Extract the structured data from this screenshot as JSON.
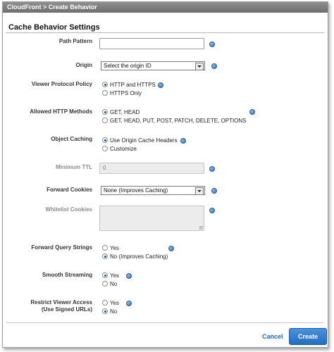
{
  "window": {
    "title": "CloudFront > Create Behavior"
  },
  "section": {
    "title": "Cache Behavior Settings"
  },
  "fields": {
    "path_pattern": {
      "label": "Path Pattern",
      "value": ""
    },
    "origin": {
      "label": "Origin",
      "selected": "Select the origin ID"
    },
    "viewer_protocol_policy": {
      "label": "Viewer Protocol Policy",
      "options": [
        "HTTP and HTTPS",
        "HTTPS Only"
      ],
      "selected_index": 0
    },
    "allowed_http_methods": {
      "label": "Allowed HTTP Methods",
      "options": [
        "GET, HEAD",
        "GET, HEAD, PUT, POST, PATCH, DELETE, OPTIONS"
      ],
      "selected_index": 0
    },
    "object_caching": {
      "label": "Object Caching",
      "options": [
        "Use Origin Cache Headers",
        "Customize"
      ],
      "selected_index": 0
    },
    "minimum_ttl": {
      "label": "Minimum TTL",
      "value": "0"
    },
    "forward_cookies": {
      "label": "Forward Cookies",
      "selected": "None (Improves Caching)"
    },
    "whitelist_cookies": {
      "label": "Whitelist Cookies",
      "value": ""
    },
    "forward_query_strings": {
      "label": "Forward Query Strings",
      "options": [
        "Yes",
        "No (Improves Caching)"
      ],
      "selected_index": 1
    },
    "smooth_streaming": {
      "label": "Smooth Streaming",
      "options": [
        "Yes",
        "No"
      ],
      "selected_index": 0
    },
    "restrict_viewer_access": {
      "label_line1": "Restrict Viewer Access",
      "label_line2": "(Use Signed URLs)",
      "options": [
        "Yes",
        "No"
      ],
      "selected_index": 1
    }
  },
  "footer": {
    "cancel_label": "Cancel",
    "create_label": "Create"
  },
  "icons": {
    "info": "info-icon"
  },
  "colors": {
    "accent": "#236ec2",
    "titlebar": "#7a7a7a"
  }
}
